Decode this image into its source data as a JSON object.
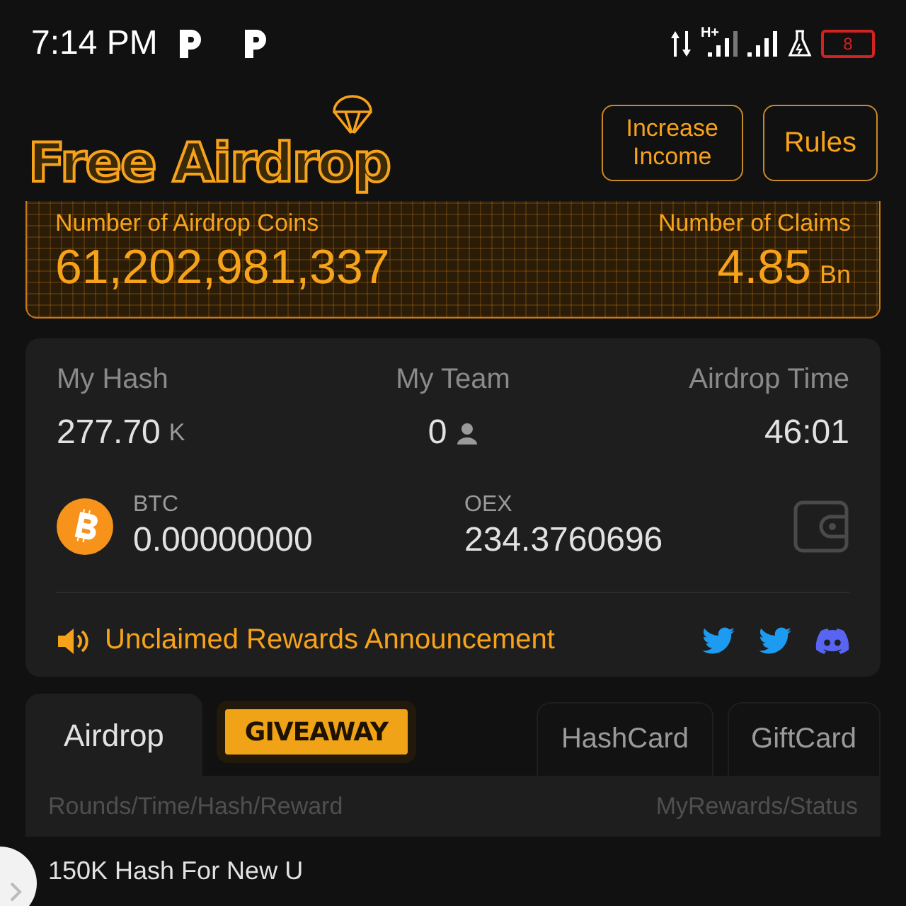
{
  "status_bar": {
    "time": "7:14 PM",
    "network_type": "H+",
    "battery_level_text": "8"
  },
  "header": {
    "logo": "Free Airdrop",
    "buttons": [
      "Increase Income",
      "Rules"
    ]
  },
  "airdrop_summary": {
    "coins_label": "Number of Airdrop Coins",
    "coins_value": "61,202,981,337",
    "claims_label": "Number of Claims",
    "claims_value": "4.85",
    "claims_unit": "Bn"
  },
  "stats": [
    {
      "label": "My Hash",
      "value": "277.70",
      "unit": "K",
      "kind": "unit"
    },
    {
      "label": "My Team",
      "value": "0",
      "kind": "team"
    },
    {
      "label": "Airdrop Time",
      "value": "46:01",
      "kind": "plain"
    }
  ],
  "balances": [
    {
      "currency": "BTC",
      "amount": "0.00000000",
      "kind": "btc"
    },
    {
      "currency": "OEX",
      "amount": "234.3760696",
      "kind": "plain"
    }
  ],
  "announcement": "Unclaimed Rewards Announcement",
  "tabs": [
    {
      "label": "Airdrop",
      "selected": true,
      "kind": "text"
    },
    {
      "label": "GIVEAWAY",
      "selected": false,
      "kind": "banner"
    },
    {
      "label": "HashCard",
      "selected": false,
      "kind": "text"
    },
    {
      "label": "GiftCard",
      "selected": false,
      "kind": "text"
    }
  ],
  "table": {
    "columns": [
      "Rounds/Time/Hash/Reward",
      "MyRewards/Status"
    ],
    "rows": [
      {
        "column_1": "150K Hash For New U"
      }
    ]
  }
}
